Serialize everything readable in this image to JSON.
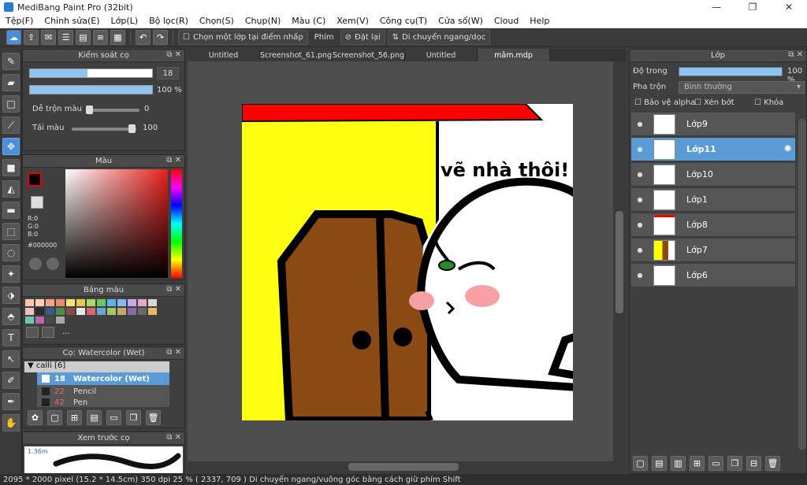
{
  "app": {
    "title": "MediBang Paint Pro (32bit)"
  },
  "menu": [
    "Tệp(F)",
    "Chỉnh sửa(E)",
    "Lớp(L)",
    "Bộ lọc(R)",
    "Chọn(S)",
    "Chụp(N)",
    "Màu (C)",
    "Xem(V)",
    "Công cụ(T)",
    "Cửa sổ(W)",
    "Cloud",
    "Help"
  ],
  "toolbar": {
    "option_label": "Chọn một lớp tại điểm nhấp",
    "key_label": "Phím",
    "reset_label": "Đặt lại",
    "move_label": "Di chuyển ngang/dọc"
  },
  "brush_control": {
    "title": "Kiểm soát cọ",
    "size": "18",
    "opacity": "100 %",
    "size_fill": 0.47,
    "opacity_fill": 1.0,
    "blend_label": "Dễ trộn màu",
    "blend_value": "0",
    "remix_label": "Tải màu",
    "remix_value": "100"
  },
  "color": {
    "title": "Màu",
    "r": "R:0",
    "g": "G:0",
    "b": "B:0",
    "hex": "#000000",
    "primary": "#000000"
  },
  "palette": {
    "title": "Bảng màu",
    "more": "..."
  },
  "brush": {
    "title": "Cọ: Watercolor (Wet)",
    "group": "calli [6]",
    "items": [
      {
        "num": "18",
        "name": "Watercolor (Wet)"
      },
      {
        "num": "22",
        "name": "Pencil"
      },
      {
        "num": "42",
        "name": "Pen"
      }
    ]
  },
  "preview": {
    "title": "Xem trước cọ",
    "size": "1.36m"
  },
  "tabs": [
    "Untitled",
    "Screenshot_61.png",
    "Screenshot_56.png",
    "Untitled",
    "mâm.mdp"
  ],
  "canvas": {
    "text": "vẽ nhà thôi!"
  },
  "layers": {
    "title": "Lớp",
    "opacity_label": "Độ trong",
    "opacity_value": "100 %",
    "blend_label": "Pha trộn",
    "blend_value": "Bình thường",
    "protect_alpha": "Bảo vệ alpha",
    "clipping": "Xén bớt",
    "lock": "Khóa",
    "items": [
      "Lớp9",
      "Lớp11",
      "Lớp10",
      "Lớp1",
      "Lớp8",
      "Lớp7",
      "Lớp6"
    ]
  },
  "status": {
    "text": "2095 * 2000 pixel   (15.2 * 14.5cm)   350 dpi   25 %   ( 2337, 709 )   Di chuyển ngang/vuông góc bằng cách giữ phím Shift"
  }
}
